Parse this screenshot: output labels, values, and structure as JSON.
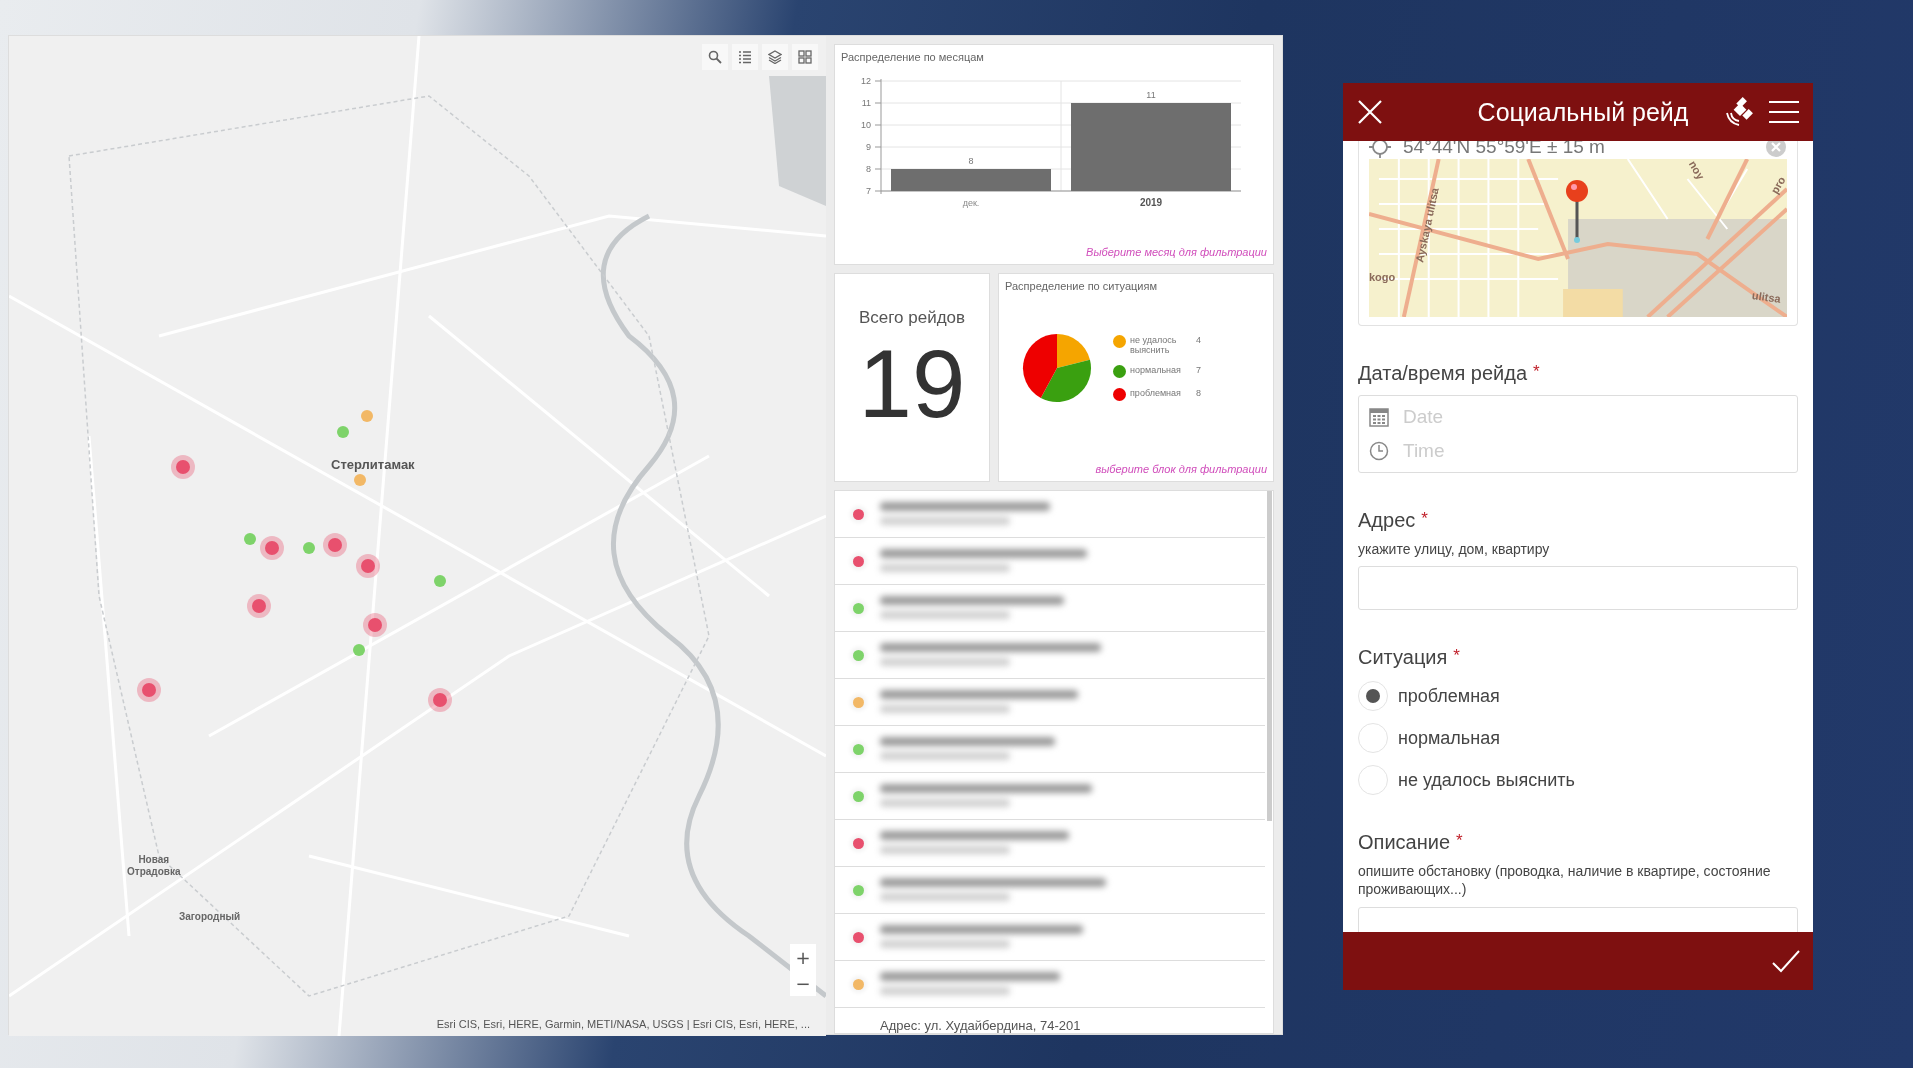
{
  "map": {
    "labels": [
      {
        "text": "Стерлитамак",
        "kind": "city"
      },
      {
        "text": "Новая\nОтрадовка",
        "kind": "place"
      },
      {
        "text": "Загородный",
        "kind": "place"
      }
    ],
    "markers": [
      {
        "color": "#e8506e"
      },
      {
        "color": "#f2b866"
      },
      {
        "color": "#7ed36a"
      },
      {
        "color": "#f2b866"
      },
      {
        "color": "#7ed36a"
      },
      {
        "color": "#e8506e"
      },
      {
        "color": "#7ed36a"
      },
      {
        "color": "#e8506e"
      },
      {
        "color": "#e8506e"
      },
      {
        "color": "#7ed36a"
      },
      {
        "color": "#e8506e"
      },
      {
        "color": "#e8506e"
      },
      {
        "color": "#7ed36a"
      },
      {
        "color": "#e8506e"
      },
      {
        "color": "#e8506e"
      }
    ],
    "zoom_in": "+",
    "zoom_out": "−",
    "attribution": "Esri CIS, Esri, HERE, Garmin, METI/NASA, USGS | Esri CIS, Esri, HERE, ..."
  },
  "monthly": {
    "title": "Распределение по месяцам",
    "hint": "Выберите месяц для фильтрации",
    "chart_data": {
      "type": "bar",
      "categories": [
        "дек.",
        "2019"
      ],
      "values": [
        8,
        11
      ],
      "ylim": [
        7,
        12
      ],
      "yticks": [
        7,
        8,
        9,
        10,
        11,
        12
      ],
      "data_labels": true,
      "grid": true
    }
  },
  "total": {
    "label": "Всего рейдов",
    "value": "19"
  },
  "situations": {
    "title": "Распределение по ситуациям",
    "hint": "выберите блок для фильтрации",
    "legend": [
      {
        "count": "4",
        "color": "#f5a500"
      },
      {
        "count": "7",
        "color": "#3aa010"
      },
      {
        "count": "8",
        "color": "#ee0000"
      }
    ],
    "chart_data": {
      "type": "pie",
      "categories": [
        "не удалось выяснить",
        "нормальная",
        "проблемная"
      ],
      "values": [
        21.05,
        36.84,
        42.11
      ]
    }
  },
  "records": {
    "items": [
      {
        "color": "#e8506e"
      },
      {
        "color": "#e8506e"
      },
      {
        "color": "#7ed36a"
      },
      {
        "color": "#7ed36a"
      },
      {
        "color": "#f2b866"
      },
      {
        "color": "#7ed36a"
      },
      {
        "color": "#7ed36a"
      },
      {
        "color": "#e8506e"
      },
      {
        "color": "#7ed36a"
      },
      {
        "color": "#e8506e"
      },
      {
        "color": "#f2b866"
      }
    ],
    "last_item": "Адрес: ул. Худайбердина, 74-201"
  },
  "form": {
    "title": "Социальный рейд",
    "location": "54°44'N 55°59'E ± 15 m",
    "map_labels": [
      "Ayskaya ulitsa",
      "ulitsa",
      "kogo",
      "pro",
      "noy"
    ],
    "datetime": {
      "label": "Дата/время рейда",
      "date_placeholder": "Date",
      "time_placeholder": "Time"
    },
    "address": {
      "label": "Адрес",
      "hint": "укажите улицу, дом, квартиру"
    },
    "situation": {
      "label": "Ситуация",
      "options": [
        {
          "label": "проблемная",
          "selected": true
        },
        {
          "label": "нормальная",
          "selected": false
        },
        {
          "label": "не удалось выяснить",
          "selected": false
        }
      ]
    },
    "description": {
      "label": "Описание",
      "hint": "опишите обстановку (проводка, наличие в квартире, состояние проживающих...)"
    },
    "required_mark": "*"
  }
}
